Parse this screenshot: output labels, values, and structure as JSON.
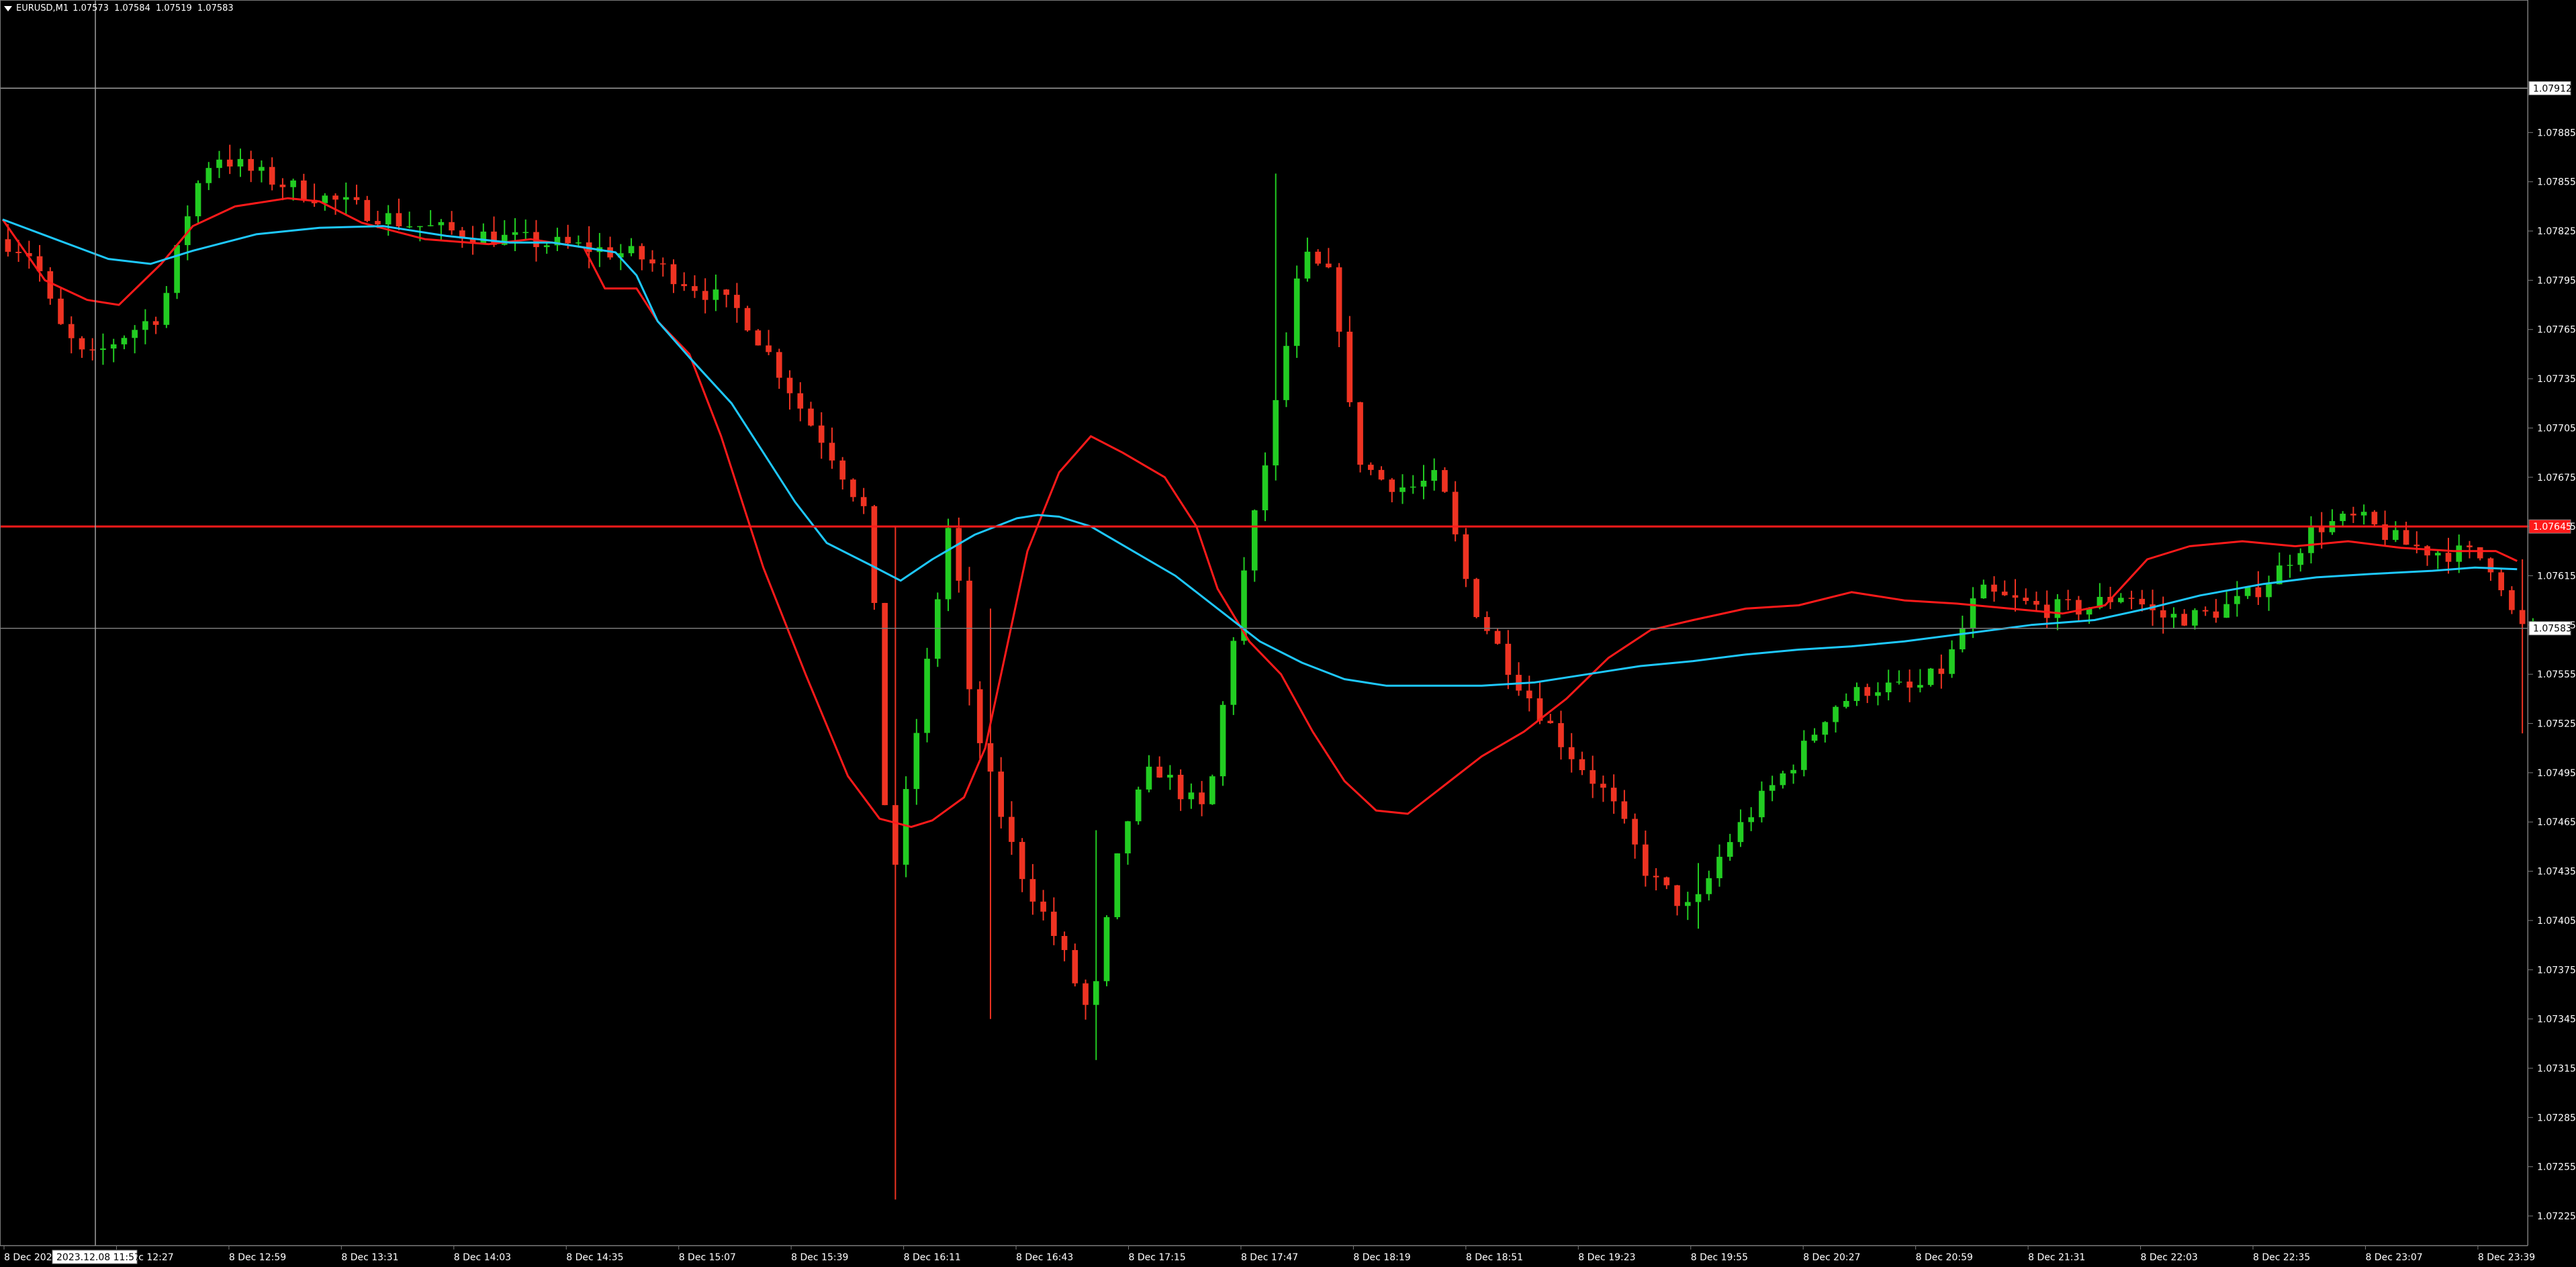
{
  "symbol": {
    "name": "EURUSD,M1",
    "ohlc": [
      "1.07573",
      "1.07584",
      "1.07519",
      "1.07583"
    ]
  },
  "chart_data": {
    "type": "candlestick",
    "timeframe": "M1",
    "x_labels": [
      "8 Dec 2023",
      "8 Dec 12:27",
      "8 Dec 12:59",
      "8 Dec 13:31",
      "8 Dec 14:03",
      "8 Dec 14:35",
      "8 Dec 15:07",
      "8 Dec 15:39",
      "8 Dec 16:11",
      "8 Dec 16:43",
      "8 Dec 17:15",
      "8 Dec 17:47",
      "8 Dec 18:19",
      "8 Dec 18:51",
      "8 Dec 19:23",
      "8 Dec 19:55",
      "8 Dec 20:27",
      "8 Dec 20:59",
      "8 Dec 21:31",
      "8 Dec 22:03",
      "8 Dec 22:35",
      "8 Dec 23:07",
      "8 Dec 23:39"
    ],
    "y_ticks": [
      "1.07885",
      "1.07855",
      "1.07825",
      "1.07795",
      "1.07765",
      "1.07735",
      "1.07705",
      "1.07675",
      "1.07645",
      "1.07615",
      "1.07585",
      "1.07555",
      "1.07525",
      "1.07495",
      "1.07465",
      "1.07435",
      "1.07405",
      "1.07375",
      "1.07345",
      "1.07315",
      "1.07285",
      "1.07255",
      "1.07225"
    ],
    "ylim": [
      1.07207,
      1.07942
    ],
    "xlim": [
      0,
      239
    ],
    "price_path": [
      [
        0,
        1.0782
      ],
      [
        3,
        1.0781
      ],
      [
        5,
        1.0777
      ],
      [
        8,
        1.07745
      ],
      [
        11,
        1.0776
      ],
      [
        15,
        1.07775
      ],
      [
        18,
        1.07848
      ],
      [
        20,
        1.07872
      ],
      [
        24,
        1.0786
      ],
      [
        28,
        1.0785
      ],
      [
        33,
        1.0784
      ],
      [
        38,
        1.0783
      ],
      [
        42,
        1.07825
      ],
      [
        48,
        1.0782
      ],
      [
        55,
        1.07815
      ],
      [
        60,
        1.0781
      ],
      [
        63,
        1.078
      ],
      [
        66,
        1.0779
      ],
      [
        70,
        1.07775
      ],
      [
        74,
        1.07735
      ],
      [
        76,
        1.07712
      ],
      [
        78,
        1.07695
      ],
      [
        82,
        1.0765
      ],
      [
        84,
        1.0742
      ],
      [
        87,
        1.0754
      ],
      [
        90,
        1.07665
      ],
      [
        91,
        1.07555
      ],
      [
        93,
        1.075
      ],
      [
        96,
        1.0744
      ],
      [
        100,
        1.0739
      ],
      [
        103,
        1.07345
      ],
      [
        106,
        1.0746
      ],
      [
        109,
        1.075
      ],
      [
        112,
        1.0748
      ],
      [
        114,
        1.0747
      ],
      [
        117,
        1.076
      ],
      [
        120,
        1.077
      ],
      [
        123,
        1.0781
      ],
      [
        126,
        1.07795
      ],
      [
        128,
        1.0769
      ],
      [
        130,
        1.07675
      ],
      [
        133,
        1.07668
      ],
      [
        136,
        1.07675
      ],
      [
        139,
        1.076
      ],
      [
        143,
        1.07555
      ],
      [
        148,
        1.0751
      ],
      [
        152,
        1.0748
      ],
      [
        156,
        1.0743
      ],
      [
        160,
        1.0741
      ],
      [
        163,
        1.0745
      ],
      [
        166,
        1.07475
      ],
      [
        170,
        1.07505
      ],
      [
        173,
        1.07535
      ],
      [
        177,
        1.07548
      ],
      [
        181,
        1.07545
      ],
      [
        184,
        1.0756
      ],
      [
        187,
        1.07605
      ],
      [
        190,
        1.076
      ],
      [
        193,
        1.07595
      ],
      [
        197,
        1.07595
      ],
      [
        201,
        1.07605
      ],
      [
        204,
        1.0759
      ],
      [
        208,
        1.0759
      ],
      [
        212,
        1.076
      ],
      [
        215,
        1.07615
      ],
      [
        219,
        1.07645
      ],
      [
        223,
        1.0765
      ],
      [
        227,
        1.07635
      ],
      [
        230,
        1.0763
      ],
      [
        234,
        1.07628
      ],
      [
        236,
        1.0762
      ],
      [
        238,
        1.07583
      ]
    ],
    "candle_highlights": [
      [
        84,
        1.07645,
        1.07235
      ],
      [
        93,
        1.07345,
        1.07595
      ],
      [
        103,
        1.0732,
        1.0746
      ],
      [
        120,
        1.07755,
        1.0786
      ],
      [
        160,
        1.074,
        1.0744
      ],
      [
        238,
        1.07519,
        1.07625
      ]
    ],
    "series": [
      {
        "name": "",
        "color": "#ff1a1a",
        "points": [
          [
            0,
            1.07832
          ],
          [
            4,
            1.07795
          ],
          [
            8,
            1.07783
          ],
          [
            11,
            1.0778
          ],
          [
            15,
            1.07805
          ],
          [
            18,
            1.07828
          ],
          [
            22,
            1.0784
          ],
          [
            27,
            1.07845
          ],
          [
            30,
            1.07843
          ],
          [
            34,
            1.0783
          ],
          [
            40,
            1.0782
          ],
          [
            46,
            1.07817
          ],
          [
            50,
            1.0782
          ],
          [
            55,
            1.07815
          ],
          [
            57,
            1.0779
          ],
          [
            60,
            1.0779
          ],
          [
            62,
            1.0777
          ],
          [
            65,
            1.0775
          ],
          [
            68,
            1.077
          ],
          [
            72,
            1.0762
          ],
          [
            76,
            1.07555
          ],
          [
            80,
            1.07493
          ],
          [
            83,
            1.07467
          ],
          [
            86,
            1.07462
          ],
          [
            88,
            1.07466
          ],
          [
            91,
            1.0748
          ],
          [
            93,
            1.0751
          ],
          [
            95,
            1.0757
          ],
          [
            97,
            1.0763
          ],
          [
            100,
            1.07678
          ],
          [
            103,
            1.077
          ],
          [
            106,
            1.0769
          ],
          [
            110,
            1.07675
          ],
          [
            113,
            1.07645
          ],
          [
            115,
            1.07607
          ],
          [
            118,
            1.07575
          ],
          [
            121,
            1.07555
          ],
          [
            124,
            1.0752
          ],
          [
            127,
            1.0749
          ],
          [
            130,
            1.07472
          ],
          [
            133,
            1.0747
          ],
          [
            136,
            1.07485
          ],
          [
            140,
            1.07505
          ],
          [
            144,
            1.0752
          ],
          [
            148,
            1.0754
          ],
          [
            152,
            1.07565
          ],
          [
            156,
            1.07582
          ],
          [
            160,
            1.07588
          ],
          [
            165,
            1.07595
          ],
          [
            170,
            1.07597
          ],
          [
            175,
            1.07605
          ],
          [
            180,
            1.076
          ],
          [
            185,
            1.07598
          ],
          [
            190,
            1.07595
          ],
          [
            195,
            1.07592
          ],
          [
            199,
            1.07597
          ],
          [
            203,
            1.07625
          ],
          [
            207,
            1.07633
          ],
          [
            212,
            1.07636
          ],
          [
            217,
            1.07633
          ],
          [
            222,
            1.07636
          ],
          [
            227,
            1.07632
          ],
          [
            232,
            1.0763
          ],
          [
            236,
            1.0763
          ],
          [
            238,
            1.07624
          ]
        ]
      },
      {
        "name": "",
        "color": "#1ec8ff",
        "points": [
          [
            0,
            1.07832
          ],
          [
            5,
            1.0782
          ],
          [
            10,
            1.07808
          ],
          [
            14,
            1.07805
          ],
          [
            18,
            1.07813
          ],
          [
            24,
            1.07823
          ],
          [
            30,
            1.07827
          ],
          [
            36,
            1.07828
          ],
          [
            42,
            1.07822
          ],
          [
            48,
            1.07818
          ],
          [
            52,
            1.07818
          ],
          [
            58,
            1.07812
          ],
          [
            60,
            1.07798
          ],
          [
            62,
            1.0777
          ],
          [
            65,
            1.07748
          ],
          [
            69,
            1.0772
          ],
          [
            72,
            1.0769
          ],
          [
            75,
            1.0766
          ],
          [
            78,
            1.07635
          ],
          [
            82,
            1.07622
          ],
          [
            85,
            1.07612
          ],
          [
            88,
            1.07625
          ],
          [
            92,
            1.0764
          ],
          [
            96,
            1.0765
          ],
          [
            98,
            1.07652
          ],
          [
            100,
            1.07651
          ],
          [
            103,
            1.07645
          ],
          [
            107,
            1.0763
          ],
          [
            111,
            1.07615
          ],
          [
            115,
            1.07595
          ],
          [
            119,
            1.07575
          ],
          [
            123,
            1.07562
          ],
          [
            127,
            1.07552
          ],
          [
            131,
            1.07548
          ],
          [
            135,
            1.07548
          ],
          [
            140,
            1.07548
          ],
          [
            145,
            1.0755
          ],
          [
            150,
            1.07555
          ],
          [
            155,
            1.0756
          ],
          [
            160,
            1.07563
          ],
          [
            165,
            1.07567
          ],
          [
            170,
            1.0757
          ],
          [
            175,
            1.07572
          ],
          [
            180,
            1.07575
          ],
          [
            186,
            1.0758
          ],
          [
            192,
            1.07585
          ],
          [
            198,
            1.07588
          ],
          [
            203,
            1.07595
          ],
          [
            208,
            1.07603
          ],
          [
            214,
            1.0761
          ],
          [
            219,
            1.07614
          ],
          [
            224,
            1.07616
          ],
          [
            230,
            1.07618
          ],
          [
            234,
            1.0762
          ],
          [
            238,
            1.07619
          ]
        ]
      }
    ],
    "horizontal_line": {
      "price": 1.07645,
      "color": "#ff1a1a",
      "label": "1.07645"
    },
    "bid_line": {
      "price": 1.07583,
      "label": "1.07583"
    },
    "crosshair": {
      "price": 1.07912,
      "time_label": "2023.12.08 11:57",
      "price_label": "1.07912"
    },
    "colors": {
      "background": "#000000",
      "bull": "#22cc22",
      "bear": "#ee3322",
      "grid": "#7a7a7a",
      "axis_text": "#ffffff"
    }
  }
}
